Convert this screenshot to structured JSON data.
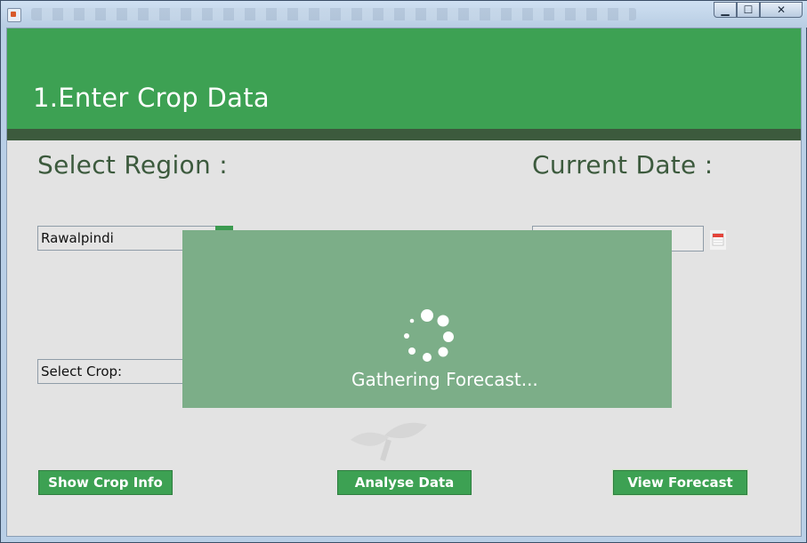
{
  "window": {
    "minimize": "▁",
    "maximize": "☐",
    "close": "✕"
  },
  "banner": {
    "title": "1.Enter Crop Data"
  },
  "region": {
    "heading": "Select Region :",
    "selected": "Rawalpindi"
  },
  "date": {
    "heading": "Current Date :",
    "value": ""
  },
  "crop": {
    "selected": "Select Crop:"
  },
  "buttons": {
    "show_crop_info": "Show Crop Info",
    "analyse_data": "Analyse Data",
    "view_forecast": "View Forecast"
  },
  "overlay": {
    "message": "Gathering Forecast..."
  },
  "colors": {
    "accent": "#3da153",
    "dark_accent": "#3c5a3d",
    "overlay": "#7cae88",
    "background": "#e3e3e3"
  }
}
